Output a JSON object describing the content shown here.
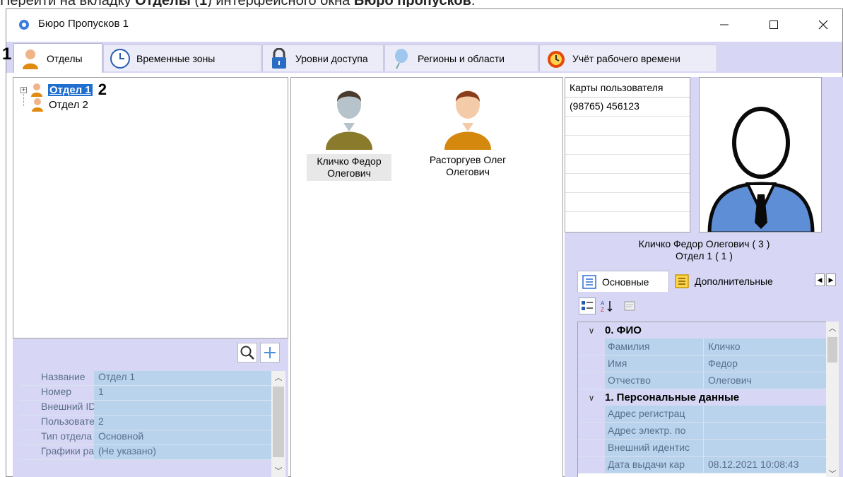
{
  "doc_caption": {
    "pre": "Перейти на вкладку ",
    "b1": "Отделы",
    "mid": " (",
    "n": "1",
    "mid2": ") интерфейсного окна ",
    "b2": "Бюро пропусков",
    "post": "."
  },
  "window": {
    "title": "Бюро Пропусков 1"
  },
  "tabs": [
    {
      "label": "Отделы",
      "icon": "person-icon"
    },
    {
      "label": "Временные зоны",
      "icon": "clock-icon"
    },
    {
      "label": "Уровни доступа",
      "icon": "padlock-icon"
    },
    {
      "label": "Регионы и области",
      "icon": "balloon-icon"
    },
    {
      "label": "Учёт рабочего времени",
      "icon": "alarm-clock-icon"
    }
  ],
  "callouts": {
    "one": "1",
    "two": "2"
  },
  "tree": [
    {
      "label": "Отдел 1",
      "selected": true,
      "expandable": true
    },
    {
      "label": "Отдел 2",
      "selected": false,
      "expandable": false
    }
  ],
  "users": [
    {
      "name_line1": "Кличко Федор",
      "name_line2": "Олегович",
      "selected": true
    },
    {
      "name_line1": "Расторгуев Олег",
      "name_line2": "Олегович",
      "selected": false
    }
  ],
  "dept_props": [
    {
      "key": "Название",
      "value": "Отдел 1"
    },
    {
      "key": "Номер",
      "value": "1"
    },
    {
      "key": "Внешний ID",
      "value": ""
    },
    {
      "key": "Пользовате.",
      "value": "2"
    },
    {
      "key": "Тип отдела",
      "value": "Основной"
    },
    {
      "key": "Графики раб",
      "value": "(Не указано)"
    }
  ],
  "cards": {
    "header": "Карты пользователя",
    "rows": [
      "(98765) 456123",
      "",
      "",
      "",
      "",
      ""
    ]
  },
  "person_caption": {
    "line1": "Кличко Федор Олегович ( 3 )",
    "line2": "Отдел 1 ( 1 )"
  },
  "subtabs": {
    "main": "Основные",
    "extra": "Дополнительные"
  },
  "property_grid": {
    "categories": [
      {
        "title": "0. ФИО",
        "rows": [
          {
            "key": "Фамилия",
            "value": "Кличко"
          },
          {
            "key": "Имя",
            "value": "Федор"
          },
          {
            "key": "Отчество",
            "value": "Олегович"
          }
        ]
      },
      {
        "title": "1. Персональные данные",
        "rows": [
          {
            "key": "Адрес регистрац",
            "value": ""
          },
          {
            "key": "Адрес электр. по",
            "value": ""
          },
          {
            "key": "Внешний идентис",
            "value": ""
          },
          {
            "key": "Дата выдачи кар",
            "value": "08.12.2021 10:08:43"
          }
        ]
      }
    ]
  },
  "colors": {
    "accent_lavender": "#d7d7f5",
    "cell_blue": "#b9d3ed",
    "selection": "#1f6fd0"
  }
}
